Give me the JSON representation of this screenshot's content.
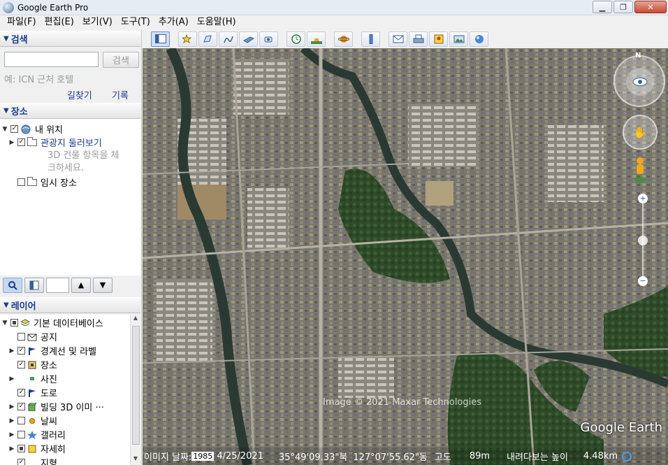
{
  "window": {
    "title": "Google Earth Pro",
    "minimize": "▁",
    "maximize": "❐",
    "close": "✕"
  },
  "menu": [
    "파일(F)",
    "편집(E)",
    "보기(V)",
    "도구(T)",
    "추가(A)",
    "도움말(H)"
  ],
  "search": {
    "header": "검색",
    "button": "검색",
    "hint": "예: ICN 근처 호텔",
    "directions": "길찾기",
    "history": "기록"
  },
  "places": {
    "header": "장소",
    "my_places": "내 위치",
    "sightseeing": "관광지 둘러보기",
    "note_line1": "3D 건물 항목을 체",
    "note_line2": "크하세요.",
    "temporary": "임시 장소"
  },
  "layers": {
    "header": "레이어",
    "items": [
      {
        "label": "기본 데이터베이스",
        "icon": "layers-stack-icon"
      },
      {
        "label": "공지",
        "icon": "envelope-icon"
      },
      {
        "label": "경계선 및 라벨",
        "icon": "flag-icon"
      },
      {
        "label": "장소",
        "icon": "place-square-icon"
      },
      {
        "label": "사진",
        "icon": "photo-icon"
      },
      {
        "label": "도로",
        "icon": "road-flag-icon"
      },
      {
        "label": "빌딩 3D 이미 ···",
        "icon": "building-3d-icon"
      },
      {
        "label": "날씨",
        "icon": "sun-icon"
      },
      {
        "label": "갤러리",
        "icon": "star-icon"
      },
      {
        "label": "자세히",
        "icon": "more-info-icon"
      },
      {
        "label": "지형",
        "icon": "terrain-icon"
      }
    ]
  },
  "map": {
    "attribution": "Image © 2021 Maxar Technologies",
    "logo": "Google Earth",
    "compass_north": "N",
    "status": {
      "image_date_label": "이미지 날짜:",
      "image_date": "4/25/2021",
      "year_overlay": "1985",
      "lat": "35°49'09.33\"북",
      "lon": "127°07'55.62\"동",
      "elevation_label": "고도",
      "elevation": "89m",
      "eye_alt_label": "내려다보는 높이",
      "eye_alt": "4.48km"
    }
  },
  "colors": {
    "accent": "#1a3b8a",
    "river": "#2a3a32"
  }
}
